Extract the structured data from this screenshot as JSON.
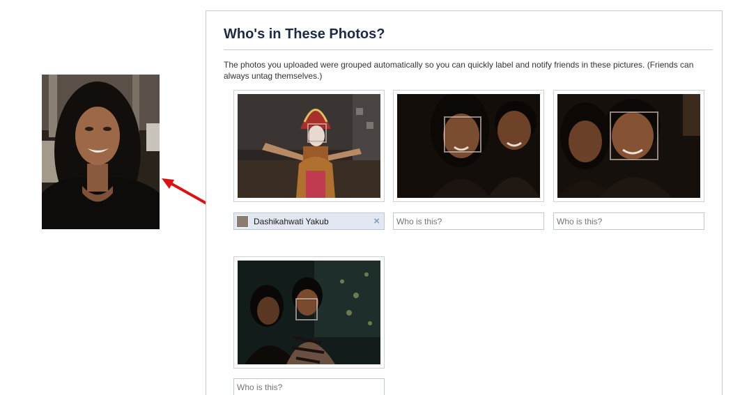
{
  "dialog": {
    "title": "Who's in These Photos?",
    "description": "The photos you uploaded were grouped automatically so you can quickly label and notify friends in these pictures. (Friends can always untag themselves.)"
  },
  "photos": [
    {
      "tag": {
        "name": "Dashikahwati Yakub",
        "remove_icon": "×"
      }
    },
    {
      "input_placeholder": "Who is this?"
    },
    {
      "input_placeholder": "Who is this?"
    },
    {
      "input_placeholder": "Who is this?"
    }
  ],
  "annotation": {
    "color": "#e01010"
  }
}
